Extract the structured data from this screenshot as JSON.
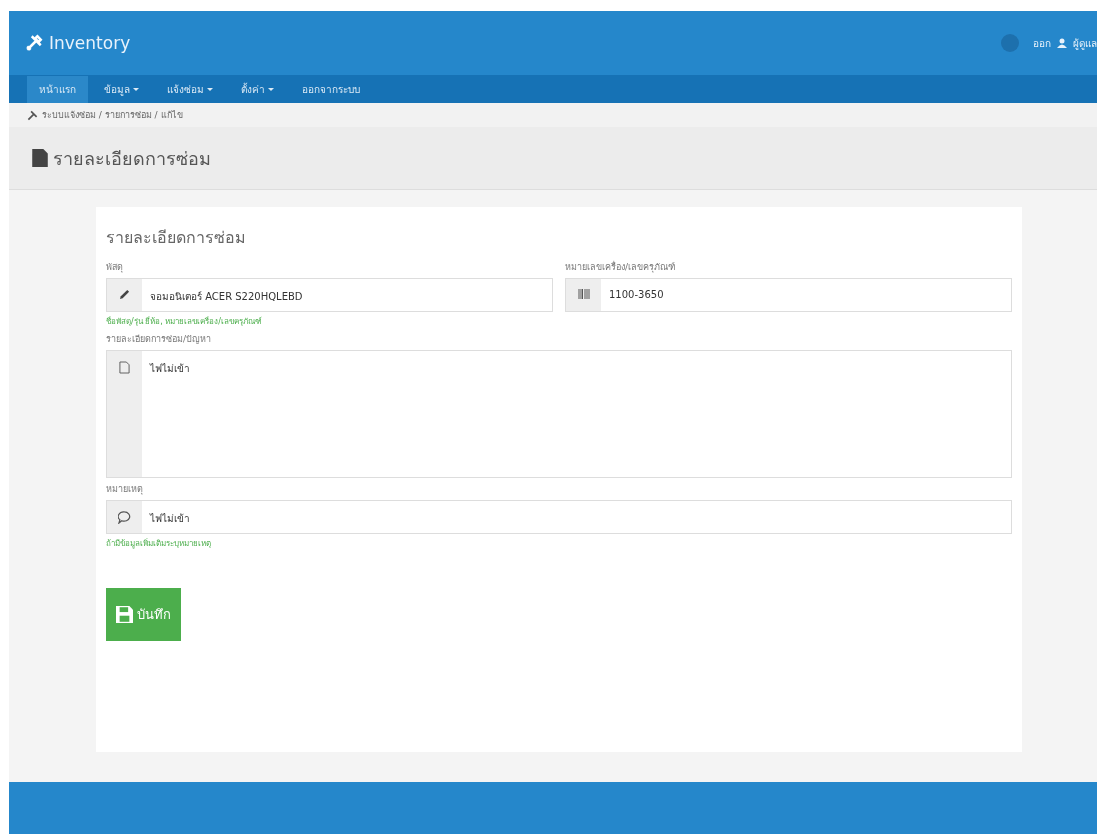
{
  "navbar": {
    "brand": "Inventory",
    "user_links": [
      "ออก",
      "ผู้ดูแล"
    ]
  },
  "menu": [
    {
      "label": "หน้าแรก",
      "dropdown": false,
      "selected": true
    },
    {
      "label": "ข้อมูล",
      "dropdown": true,
      "selected": false
    },
    {
      "label": "แจ้งซ่อม",
      "dropdown": true,
      "selected": false
    },
    {
      "label": "ตั้งค่า",
      "dropdown": true,
      "selected": false
    },
    {
      "label": "ออกจากระบบ",
      "dropdown": false,
      "selected": false
    }
  ],
  "breadcrumb": "ระบบแจ้งซ่อม / รายการซ่อม / แก้ไข",
  "page_title": "รายละเอียดการซ่อม",
  "form": {
    "title": "รายละเอียดการซ่อม",
    "item": {
      "label": "พัสดุ",
      "value": "จอมอนิเตอร์ ACER S220HQLEBD",
      "help": "ชื่อพัสดุ/รุ่น ยี่ห้อ, หมายเลขเครื่อง/เลขครุภัณฑ์"
    },
    "serial": {
      "label": "หมายเลขเครื่อง/เลขครุภัณฑ์",
      "value": "1100-3650"
    },
    "problem": {
      "label": "รายละเอียดการซ่อม/ปัญหา",
      "value": "ไฟไม่เข้า"
    },
    "note": {
      "label": "หมายเหตุ",
      "value": "ไฟไม่เข้า",
      "help": "ถ้ามีข้อมูลเพิ่มเติมระบุหมายเหตุ"
    },
    "save_button": "บันทึก"
  }
}
